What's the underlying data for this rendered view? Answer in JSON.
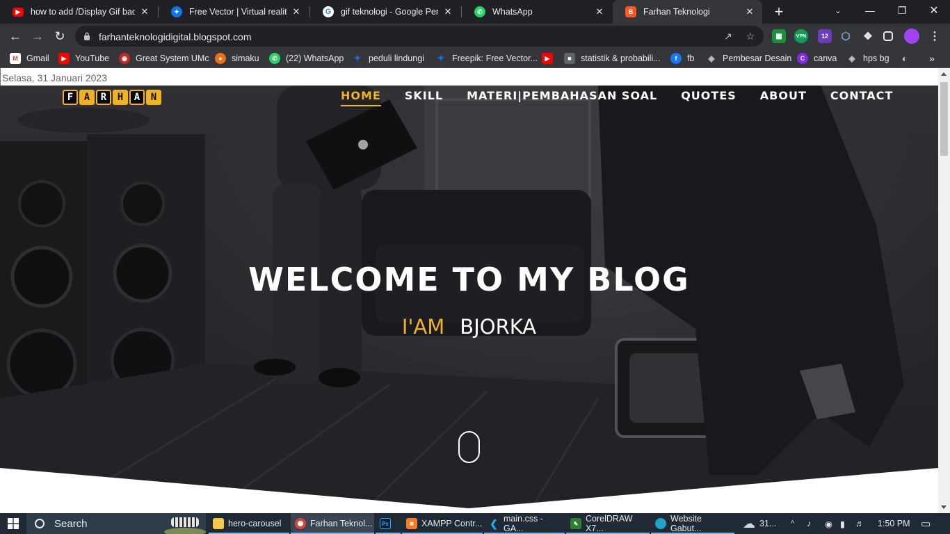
{
  "browser": {
    "tabs": [
      {
        "title": "how to add /Display Gif back",
        "icon": "youtube-icon"
      },
      {
        "title": "Free Vector | Virtual reality la",
        "icon": "freepik-icon"
      },
      {
        "title": "gif teknologi - Google Penelu",
        "icon": "google-icon"
      },
      {
        "title": "WhatsApp",
        "icon": "whatsapp-icon"
      },
      {
        "title": "Farhan Teknologi",
        "icon": "blogger-icon",
        "active": true
      }
    ],
    "url": "farhanteknologidigital.blogspot.com",
    "extension_badge": "12",
    "bookmarks": [
      {
        "label": "Gmail",
        "icon": "gmail-icon"
      },
      {
        "label": "YouTube",
        "icon": "youtube-icon"
      },
      {
        "label": "Great System UMc",
        "icon": "umc-icon"
      },
      {
        "label": "simaku",
        "icon": "simaku-icon"
      },
      {
        "label": "(22) WhatsApp",
        "icon": "whatsapp-icon"
      },
      {
        "label": "peduli lindungi",
        "icon": "freepik-icon"
      },
      {
        "label": "Freepik: Free Vector...",
        "icon": "freepik-icon"
      },
      {
        "label": "",
        "icon": "youtube-icon"
      },
      {
        "label": "statistik & probabili...",
        "icon": "classroom-icon"
      },
      {
        "label": "fb",
        "icon": "facebook-icon"
      },
      {
        "label": "Pembesar Desain",
        "icon": "layers-icon"
      },
      {
        "label": "canva",
        "icon": "canva-icon"
      },
      {
        "label": "hps bg",
        "icon": "layers-icon"
      },
      {
        "label": "",
        "icon": "globe-icon"
      }
    ]
  },
  "page": {
    "date": "Selasa, 31 Januari 2023",
    "logo_letters": [
      "F",
      "A",
      "R",
      "H",
      "A",
      "N"
    ],
    "nav": [
      "HOME",
      "SKILL",
      "MATERI|PEMBAHASAN SOAL",
      "QUOTES",
      "ABOUT",
      "CONTACT"
    ],
    "active_nav": "HOME",
    "headline": "WELCOME TO MY BLOG",
    "subline_prefix": "I'AM",
    "subline_name": "BJORKA"
  },
  "taskbar": {
    "search_placeholder": "Search",
    "apps": [
      {
        "label": "hero-carousel",
        "icon": "folder-icon"
      },
      {
        "label": "Farhan Teknol...",
        "icon": "chrome-icon",
        "active": true
      },
      {
        "label": "",
        "icon": "photoshop-icon"
      },
      {
        "label": "XAMPP Contr...",
        "icon": "xampp-icon"
      },
      {
        "label": "main.css - GA...",
        "icon": "vscode-icon"
      },
      {
        "label": "CorelDRAW X7...",
        "icon": "coreldraw-icon"
      },
      {
        "label": "Website Gabut...",
        "icon": "edge-icon"
      }
    ],
    "weather": "31...",
    "time": "1:50 PM"
  },
  "colors": {
    "accent": "#f0b323",
    "chrome_dark": "#202124",
    "chrome_toolbar": "#35363a",
    "taskbar": "#1f2a35"
  }
}
